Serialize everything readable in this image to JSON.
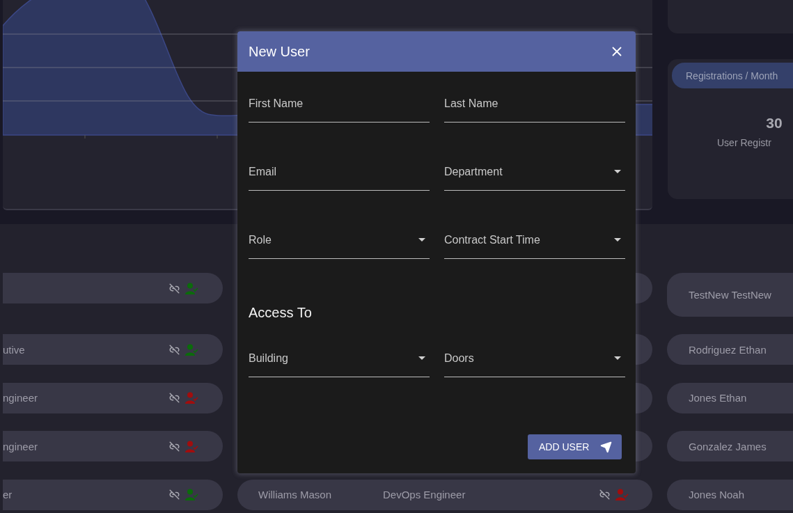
{
  "registrations": {
    "label": "Registrations / Month",
    "value": "30",
    "caption": "User Registr"
  },
  "rows": [
    {
      "left": {
        "active": true
      },
      "right": {
        "name": "TestNew TestNew"
      }
    },
    {
      "left": {
        "text": "utive",
        "active": true
      },
      "right": {
        "name": "Rodriguez Ethan"
      }
    },
    {
      "left": {
        "text": "ngineer",
        "active": false
      },
      "right": {
        "name": "Jones Ethan"
      }
    },
    {
      "left": {
        "text": "ngineer",
        "active": false
      },
      "right": {
        "name": "Gonzalez James"
      }
    },
    {
      "left": {
        "text": "er",
        "active": true
      },
      "middle": {
        "name": "Williams Mason",
        "role": "DevOps Engineer",
        "active": false
      },
      "right": {
        "name": "Jones Noah"
      }
    }
  ],
  "dialog": {
    "title": "New User",
    "fields": [
      {
        "label": "First Name",
        "kind": "text"
      },
      {
        "label": "Last Name",
        "kind": "text"
      },
      {
        "label": "Email",
        "kind": "text"
      },
      {
        "label": "Department",
        "kind": "select"
      },
      {
        "label": "Role",
        "kind": "select"
      },
      {
        "label": "Contract Start Time",
        "kind": "select"
      }
    ],
    "section": "Access To",
    "access_fields": [
      {
        "label": "Building",
        "kind": "select"
      },
      {
        "label": "Doors",
        "kind": "select"
      }
    ],
    "button": "ADD USER"
  }
}
